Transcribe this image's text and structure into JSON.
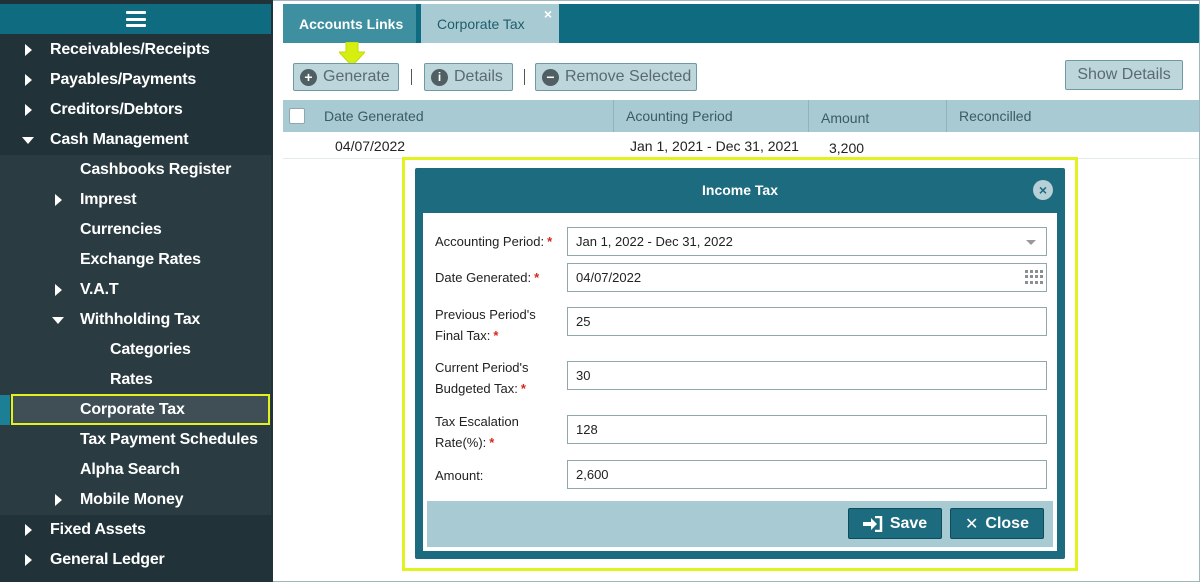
{
  "sidebar": {
    "items": [
      {
        "label": "Receivables/Receipts"
      },
      {
        "label": "Payables/Payments"
      },
      {
        "label": "Creditors/Debtors"
      },
      {
        "label": "Cash Management"
      },
      {
        "label": "Cashbooks Register"
      },
      {
        "label": "Imprest"
      },
      {
        "label": "Currencies"
      },
      {
        "label": "Exchange Rates"
      },
      {
        "label": "V.A.T"
      },
      {
        "label": "Withholding Tax"
      },
      {
        "label": "Categories"
      },
      {
        "label": "Rates"
      },
      {
        "label": "Corporate Tax"
      },
      {
        "label": "Tax Payment Schedules"
      },
      {
        "label": "Alpha Search"
      },
      {
        "label": "Mobile Money"
      },
      {
        "label": "Fixed Assets"
      },
      {
        "label": "General Ledger"
      }
    ]
  },
  "tabs": [
    {
      "label": "Accounts Links"
    },
    {
      "label": "Corporate Tax",
      "close": "×"
    }
  ],
  "toolbar": {
    "generate": "Generate",
    "details": "Details",
    "remove_selected": "Remove Selected",
    "show_details": "Show Details"
  },
  "grid": {
    "columns": [
      "Date Generated",
      "Acounting Period",
      "Amount",
      "Reconcilled"
    ],
    "rows": [
      {
        "date_generated": "04/07/2022",
        "period": "Jan 1, 2021 - Dec 31, 2021",
        "amount": "3,200",
        "reconcilled": ""
      }
    ]
  },
  "modal": {
    "title": "Income Tax",
    "fields": {
      "accounting_period": {
        "label": "Accounting Period:",
        "value": "Jan 1, 2022 - Dec 31, 2022",
        "required": "*"
      },
      "date_generated": {
        "label": "Date Generated:",
        "value": "04/07/2022",
        "required": "*"
      },
      "prev_final_tax": {
        "label_line1": "Previous Period's",
        "label_line2": "Final Tax:",
        "value": "25",
        "required": "*"
      },
      "curr_budgeted_tax": {
        "label_line1": "Current Period's",
        "label_line2": "Budgeted Tax:",
        "value": "30",
        "required": "*"
      },
      "tax_escalation": {
        "label_line1": "Tax Escalation",
        "label_line2": "Rate(%):",
        "value": "128",
        "required": "*"
      },
      "amount": {
        "label": "Amount:",
        "value": "2,600"
      }
    },
    "save": "Save",
    "close": "Close",
    "x": "×"
  },
  "colors": {
    "accent": "#0f6b7f",
    "highlight": "#e2f21e",
    "sidebar_bg": "#213339",
    "grid_header": "#a8cbd3"
  }
}
